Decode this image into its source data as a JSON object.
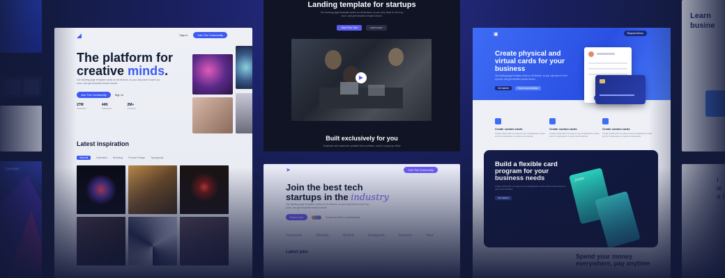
{
  "card_a": {
    "nav": {
      "signin": "Sign in",
      "cta": "Join The Community"
    },
    "headline_main": "The platform for",
    "headline_plain": "creative",
    "headline_highlight": "minds",
    "headline_period": ".",
    "description": "Our landing page template works on all devices, so you only have to set it up once, and get beautiful results forever.",
    "cta_primary": "Join The Community",
    "cta_secondary": "Sign In",
    "stats": [
      {
        "value": "27M",
        "label": "Inspiration"
      },
      {
        "value": "44K",
        "label": "Collections"
      },
      {
        "value": "2M+",
        "label": "Creatives"
      }
    ],
    "section_title": "Latest inspiration",
    "tabs": [
      "View All",
      "Illustration",
      "Branding",
      "Product Design",
      "Typography"
    ]
  },
  "card_b": {
    "title": "Landing template for startups",
    "subtitle": "Our landing page template works on all devices, so you only have to set it up once, and get beautiful results forever.",
    "btn_primary": "Start Free Trial",
    "btn_secondary": "Learn more",
    "play_glyph": "▶",
    "section_title": "Built exclusively for you",
    "section_sub": "Duplicate and customize updated test providers, such is scope go office"
  },
  "card_c": {
    "nav_cta": "Join The Community",
    "headline_main": "Join the best tech startups in the",
    "headline_italic": "industry",
    "description": "Our landing page template works on all devices, so you only have to set it up once, and get beautiful results forever.",
    "cta": "Post a Job",
    "social_proof": "Trusted by 300K+ professionals",
    "logos": [
      "Facebook",
      "Shopify",
      "Airbnb",
      "Instagram",
      "Amazon",
      "Visa"
    ],
    "section_title": "Latest jobs"
  },
  "card_d": {
    "nav_cta": "Request Demo",
    "headline": "Create physical and virtual cards for your business",
    "description": "Our landing page template works on all devices, so you only have to set it up once, and get beautiful results forever.",
    "cta_primary": "Get started",
    "cta_secondary": "Read documentation",
    "features": [
      {
        "title": "Create custom cards",
        "desc": "Create cards with our easy-to-use configuration online and for businesses or teams and startups."
      },
      {
        "title": "Create custom cards",
        "desc": "Create cards with our easy-to-use configuration online and for businesses or teams and startups."
      },
      {
        "title": "Create custom cards",
        "desc": "Create cards with our easy-to-use configuration online and for businesses or teams and startups."
      }
    ],
    "dark_title": "Build a flexible card program for your business needs",
    "dark_desc": "Create cards with our easy-to-use configuration online and for businesses or teams and startups.",
    "dark_cta": "Get started",
    "card_brand": "Zlvlate",
    "footer_title": "Spend your money everywhere, pay anytime"
  },
  "right": {
    "title_top": "Learn busine",
    "title_bottom": "I w a f"
  },
  "left": {
    "badge": "Learn more"
  },
  "colors": {
    "accent": "#3d5af1",
    "bg": "#121a3a",
    "violet": "#6a5cf0"
  }
}
